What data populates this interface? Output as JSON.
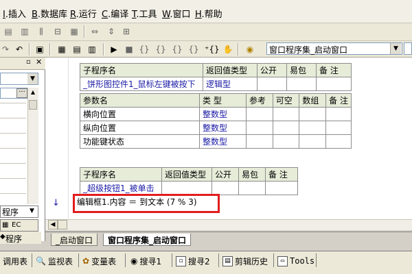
{
  "menu": {
    "items": [
      {
        "key": "I",
        "label": ".插入"
      },
      {
        "key": "B",
        "label": ".数据库"
      },
      {
        "key": "R",
        "label": ".运行"
      },
      {
        "key": "C",
        "label": ".编译"
      },
      {
        "key": "T",
        "label": ".工具"
      },
      {
        "key": "W",
        "label": ".窗口"
      },
      {
        "key": "H",
        "label": ".帮助"
      }
    ]
  },
  "toolbar": {
    "window_combo_value": "窗口程序集_启动窗口"
  },
  "left_panel": {
    "tab_program": "程序",
    "tab_ec": "EC",
    "tab_program2": "程序",
    "search_dots": "···"
  },
  "sub1": {
    "headers": [
      "子程序名",
      "返回值类型",
      "公开",
      "易包",
      "备 注"
    ],
    "row": [
      "_饼形图控件1_鼠标左键被按下",
      "逻辑型",
      "",
      "",
      ""
    ],
    "param_headers": [
      "参数名",
      "类 型",
      "参考",
      "可空",
      "数组",
      "备 注"
    ],
    "params": [
      [
        "横向位置",
        "整数型"
      ],
      [
        "纵向位置",
        "整数型"
      ],
      [
        "功能键状态",
        "整数型"
      ]
    ]
  },
  "sub2": {
    "headers": [
      "子程序名",
      "返回值类型",
      "公开",
      "易包",
      "备 注"
    ],
    "row": [
      "_超级按钮1_被单击",
      "",
      "",
      "",
      ""
    ]
  },
  "code": {
    "line": "编辑框1.内容 ＝ 到文本 (7 % 3)",
    "arrow": "↓"
  },
  "doc_tabs": [
    "_启动窗口",
    "窗口程序集_启动窗口"
  ],
  "bottom_tabs": [
    "调用表",
    "监视表",
    "变量表",
    "搜寻1",
    "搜寻2",
    "剪辑历史",
    "Tools"
  ]
}
